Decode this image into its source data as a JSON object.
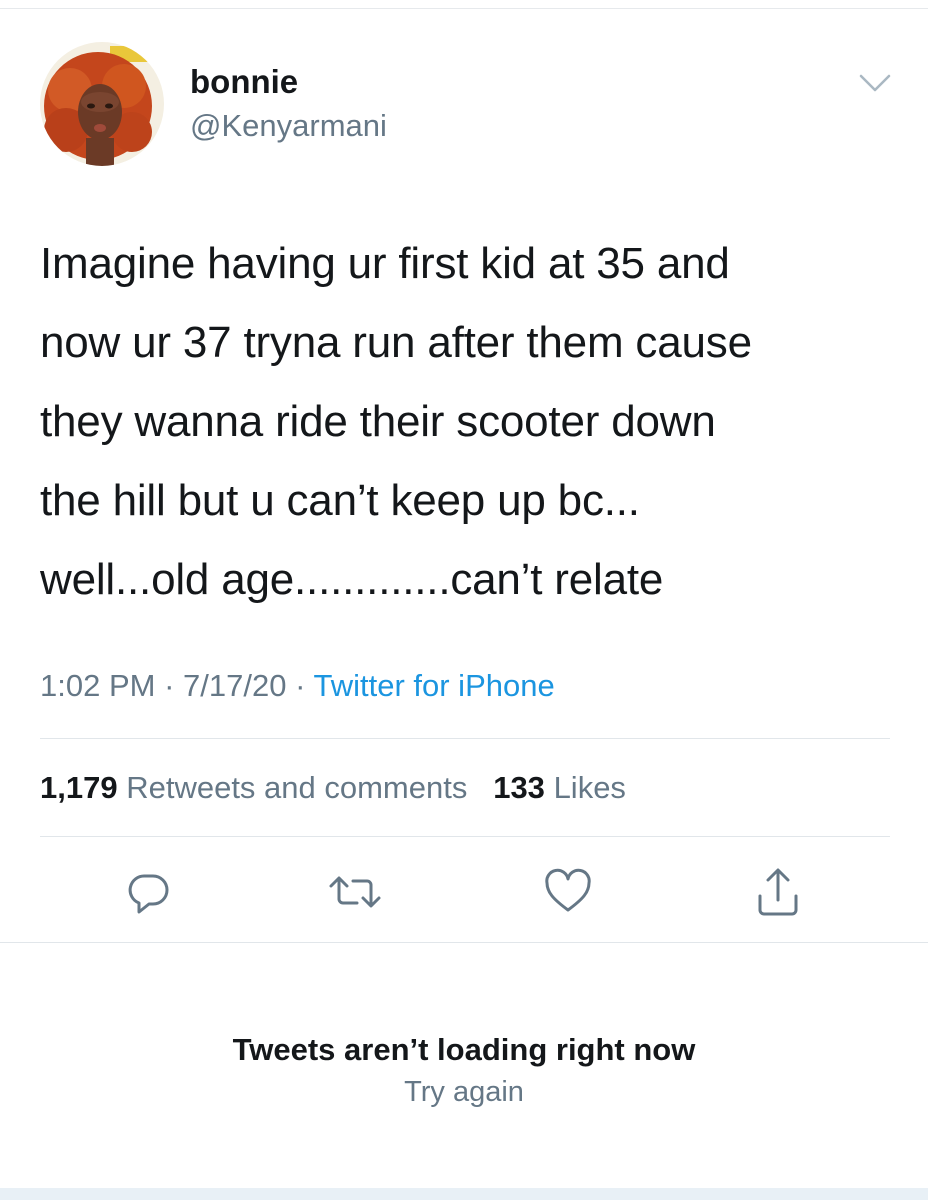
{
  "tweet": {
    "display_name": "bonnie",
    "handle": "@Kenyarmani",
    "text": "Imagine having ur first kid at 35 and\nnow ur 37 tryna run after them cause\nthey wanna ride their scooter down\nthe hill but u can’t keep up bc...\nwell...old age.............can’t relate",
    "time": "1:02 PM",
    "date": "7/17/20",
    "separator": "·",
    "source": "Twitter for iPhone",
    "retweets_count": "1,179",
    "retweets_label": "Retweets and comments",
    "likes_count": "133",
    "likes_label": "Likes"
  },
  "actions": {
    "reply_icon": "reply-icon",
    "retweet_icon": "retweet-icon",
    "like_icon": "heart-icon",
    "share_icon": "share-icon"
  },
  "empty_state": {
    "title": "Tweets aren’t loading right now",
    "retry_label": "Try again"
  },
  "colors": {
    "text_primary": "#14171a",
    "text_secondary": "#657786",
    "link": "#1b95e0",
    "divider": "#e1e6ea",
    "avatar_hair": "#c94a1e"
  }
}
